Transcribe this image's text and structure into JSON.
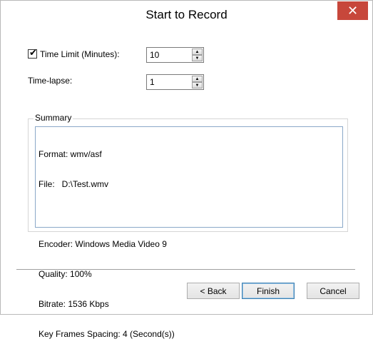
{
  "window": {
    "title": "Start to Record",
    "close_glyph": "✕"
  },
  "time_limit": {
    "checked": true,
    "check_glyph": "✔",
    "label": "Time Limit (Minutes):",
    "value": "10"
  },
  "time_lapse": {
    "label": "Time-lapse:",
    "value": "1"
  },
  "summary": {
    "group_title": "Summary",
    "lines": [
      "Format: wmv/asf",
      "File:   D:\\Test.wmv",
      "",
      "Encoder: Windows Media Video 9",
      "Quality: 100%",
      "Bitrate: 1536 Kbps",
      "Key Frames Spacing: 4 (Second(s))"
    ]
  },
  "buttons": {
    "back": "< Back",
    "finish": "Finish",
    "cancel": "Cancel"
  },
  "spin_arrows": {
    "up": "▲",
    "down": "▼"
  },
  "colors": {
    "close_button": "#c7473b",
    "summary_border": "#8aa8c8",
    "default_button_border": "#3c7fb1"
  }
}
